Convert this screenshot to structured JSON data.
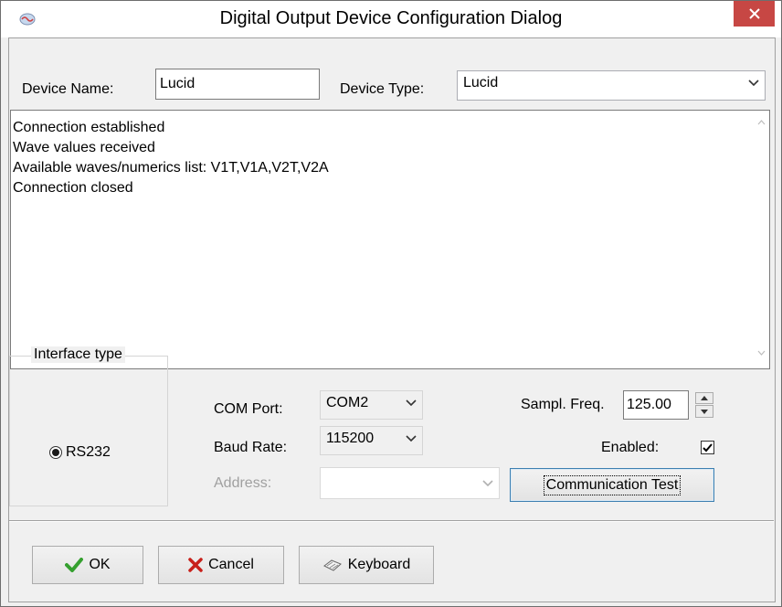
{
  "window": {
    "title": "Digital Output Device Configuration Dialog",
    "close_label": "✕"
  },
  "device": {
    "name_label": "Device Name:",
    "name_value": "Lucid",
    "type_label": "Device Type:",
    "type_value": "Lucid"
  },
  "log": {
    "lines": [
      "Connection established",
      "Wave values received",
      "Available waves/numerics list: V1T,V1A,V2T,V2A",
      "Connection closed"
    ]
  },
  "interface": {
    "group_title": "Interface type",
    "radio_label": "RS232",
    "radio_selected": true
  },
  "com": {
    "port_label": "COM Port:",
    "port_value": "COM2",
    "baud_label": "Baud Rate:",
    "baud_value": "115200",
    "address_label": "Address:",
    "address_value": ""
  },
  "sampling": {
    "freq_label": "Sampl. Freq.",
    "freq_value": "125.00",
    "enabled_label": "Enabled:",
    "enabled_checked": true
  },
  "buttons": {
    "comm_test": "Communication Test",
    "ok": "OK",
    "cancel": "Cancel",
    "keyboard": "Keyboard"
  },
  "colors": {
    "close_button": "#c74744",
    "ok_check": "#35a02f",
    "cancel_x": "#c8201a",
    "disabled_text": "#a0a0a0"
  },
  "icons": [
    "app-icon",
    "close-icon",
    "chevron-down-icon",
    "scroll-up-icon",
    "scroll-down-icon",
    "checkmark-icon",
    "x-icon",
    "keyboard-icon",
    "spin-up-icon",
    "spin-down-icon"
  ]
}
